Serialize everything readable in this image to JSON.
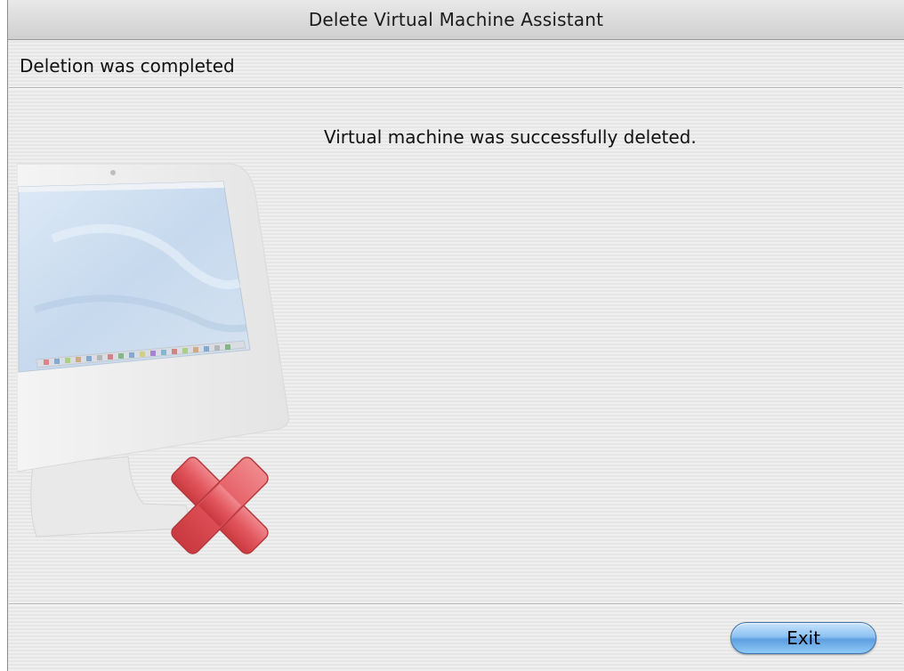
{
  "window": {
    "title": "Delete Virtual Machine Assistant"
  },
  "header": {
    "step_title": "Deletion was completed"
  },
  "main": {
    "message": "Virtual machine was successfully deleted.",
    "illustration_icon": "computer-with-red-x-icon"
  },
  "footer": {
    "exit_label": "Exit"
  },
  "colors": {
    "accent_button": "#6aa8e8",
    "delete_x": "#e0585e"
  }
}
